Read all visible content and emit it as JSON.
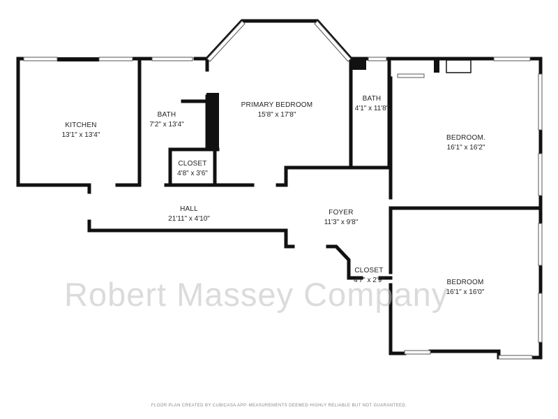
{
  "rooms": [
    {
      "name": "KITCHEN",
      "dims": "13'1\" x 13'4\""
    },
    {
      "name": "BATH",
      "dims": "7'2\" x 13'4\""
    },
    {
      "name": "PRIMARY BEDROOM",
      "dims": "15'8\" x 17'8\""
    },
    {
      "name": "BATH",
      "dims": "4'1\" x 11'8\""
    },
    {
      "name": "BEDROOM.",
      "dims": "16'1\" x 16'2\""
    },
    {
      "name": "CLOSET",
      "dims": "4'8\" x 3'6\""
    },
    {
      "name": "HALL",
      "dims": "21'11\" x 4'10\""
    },
    {
      "name": "FOYER",
      "dims": "11'3\" x 9'8\""
    },
    {
      "name": "CLOSET",
      "dims": "4'7\" x 2'9\""
    },
    {
      "name": "BEDROOM",
      "dims": "16'1\" x 16'0\""
    }
  ],
  "watermark": "Robert Massey Company",
  "footer": "FLOOR PLAN CREATED BY CUBICASA APP. MEASUREMENTS DEEMED HIGHLY RELIABLE BUT NOT GUARANTEED."
}
